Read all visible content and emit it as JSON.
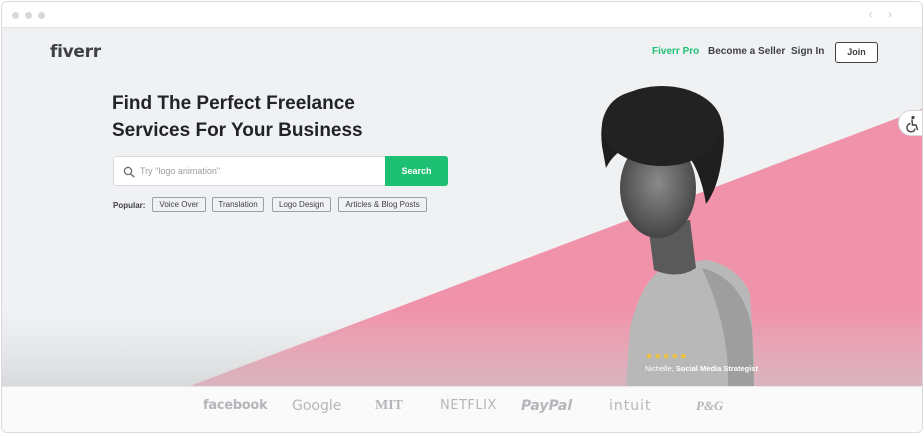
{
  "header": {
    "logo": "fiverr",
    "nav": {
      "pro": "Fiverr Pro",
      "seller": "Become a Seller",
      "signin": "Sign In",
      "join": "Join"
    }
  },
  "hero": {
    "title_line1": "Find The Perfect Freelance",
    "title_line2": "Services For Your Business",
    "search": {
      "placeholder": "Try \"logo animation\"",
      "button": "Search"
    },
    "popular_label": "Popular:",
    "popular_tags": [
      "Voice Over",
      "Translation",
      "Logo Design",
      "Articles & Blog Posts"
    ],
    "testimonial": {
      "stars": "★★★★★",
      "name": "Nichelle,",
      "role": "Social Media Strategist"
    }
  },
  "trusted_by": [
    "facebook",
    "Google",
    "MIT",
    "NETFLIX",
    "PayPal",
    "intuit",
    "P&G"
  ],
  "colors": {
    "brand_green": "#1dbf73",
    "hero_pink": "#f093aa",
    "text_dark": "#404145"
  },
  "icons": {
    "accessibility": "accessibility-icon",
    "search": "search-icon"
  }
}
